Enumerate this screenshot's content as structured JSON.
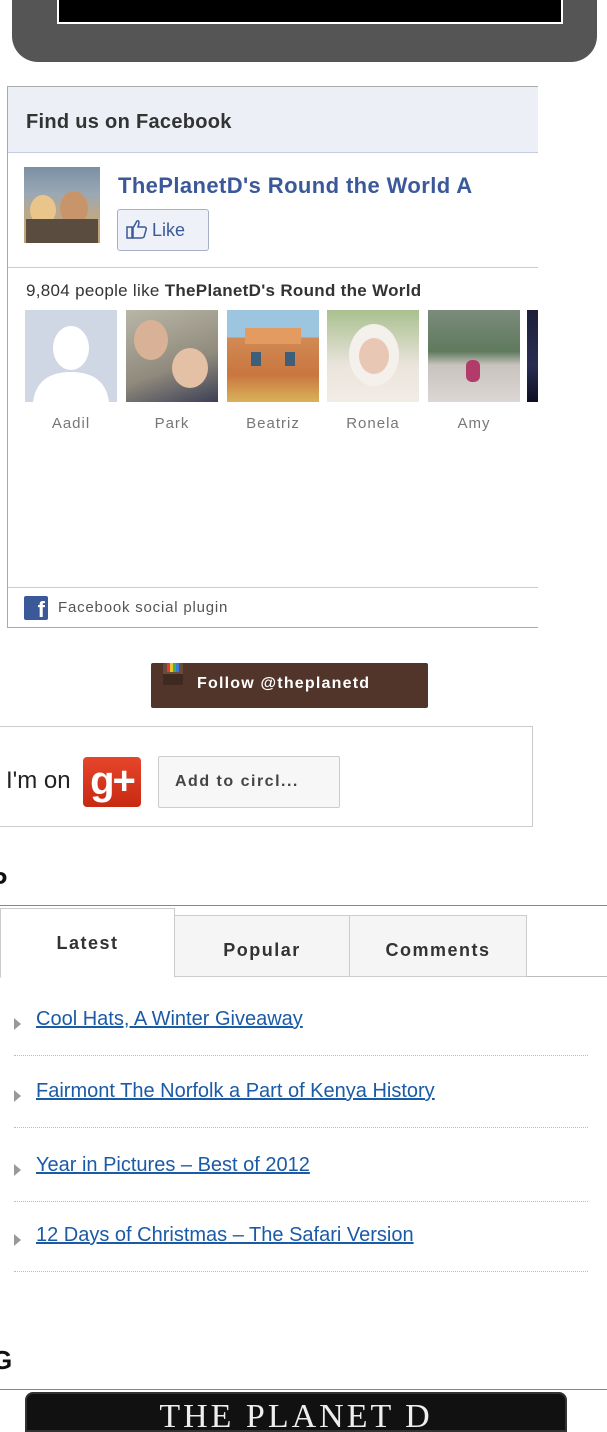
{
  "facebook": {
    "header_title": "Find us on Facebook",
    "page_name": "ThePlanetD's Round the World A",
    "like_button_label": "Like",
    "count_text": "9,804 people like",
    "count_page": "ThePlanetD's Round the World",
    "fans": [
      {
        "name": "Aadil"
      },
      {
        "name": "Park"
      },
      {
        "name": "Beatriz"
      },
      {
        "name": "Ronela"
      },
      {
        "name": "Amy"
      }
    ],
    "footer_text": "Facebook social plugin",
    "brand_color": "#3b5998"
  },
  "instagram": {
    "follow_label": "Follow @theplanetd",
    "button_color": "#51352a"
  },
  "google_plus": {
    "prefix_text": "I'm on",
    "logo_text": "g+",
    "add_button_label": "Add to circl..."
  },
  "section_letters": {
    "first": "P",
    "second": "G"
  },
  "tabs": [
    {
      "label": "Latest",
      "active": true
    },
    {
      "label": "Popular",
      "active": false
    },
    {
      "label": "Comments",
      "active": false
    }
  ],
  "posts": [
    {
      "title": "Cool Hats, A Winter Giveaway "
    },
    {
      "title": "Fairmont The Norfolk a Part of Kenya History "
    },
    {
      "title": "Year in Pictures – Best of 2012 "
    },
    {
      "title": "12 Days of Christmas – The Safari Version "
    }
  ],
  "banner": {
    "text": "THE PLANET D"
  }
}
